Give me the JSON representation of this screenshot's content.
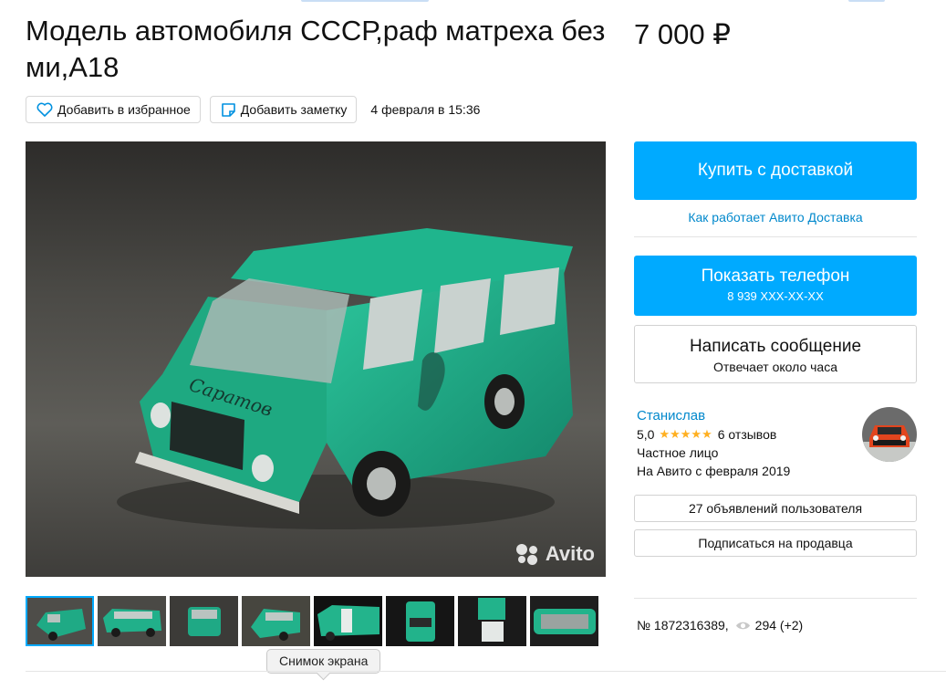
{
  "listing": {
    "title": "Модель автомобиля СССР,раф матреха без ми,А18",
    "price": "7 000 ₽",
    "date": "4 февраля в 15:36"
  },
  "actions": {
    "favorite_label": "Добавить в избранное",
    "note_label": "Добавить заметку"
  },
  "gallery": {
    "watermark": "Avito",
    "thumbnail_count": 8,
    "active_index": 0,
    "tooltip": "Снимок экрана"
  },
  "sidebar": {
    "buy_label": "Купить с доставкой",
    "how_link": "Как работает Авито Доставка",
    "phone_label": "Показать телефон",
    "phone_number": "8 939 XXX-XX-XX",
    "message_label": "Написать сообщение",
    "message_sub": "Отвечает около часа"
  },
  "seller": {
    "name": "Станислав",
    "rating": "5,0",
    "stars": "★★★★★",
    "reviews": "6 отзывов",
    "type": "Частное лицо",
    "since": "На Авито с февраля 2019",
    "listings_button": "27 объявлений пользователя",
    "subscribe_button": "Подписаться на продавца"
  },
  "meta": {
    "number": "№ 1872316389,",
    "views": "294 (+2)"
  },
  "colors": {
    "accent": "#00aaff",
    "link": "#0088cc",
    "star": "#ffb021",
    "car": "#1faa85"
  }
}
